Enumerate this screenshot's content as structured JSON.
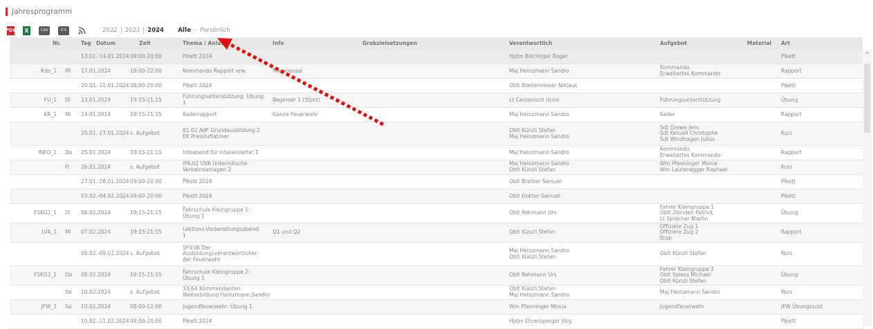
{
  "header": {
    "title": "Jahresprogramm",
    "accent_color": "#d9252a"
  },
  "toolbar": {
    "icons": [
      "pdf-icon",
      "excel-icon",
      "csv-icon",
      "ical-icon",
      "rss-icon"
    ],
    "pdf": "PDF",
    "xls": "X",
    "csv": "CSV",
    "ics": "ICS",
    "years": [
      "2022",
      "2023",
      "2024"
    ],
    "active_year": "2024",
    "filter_all": "Alle",
    "filter_sep": "-",
    "filter_personal": "Persönlich"
  },
  "table": {
    "headers": [
      "Nr.",
      "Tag",
      "Datum",
      "Zeit",
      "Thema / Anlass",
      "Info",
      "Grobzielsetzungen",
      "Verantwortlich",
      "Aufgebot",
      "Material",
      "Art"
    ],
    "rows": [
      {
        "nr": "",
        "tag": "",
        "datum": "13.01.-14.01.2024",
        "zeit": "09:00-20:00",
        "thema": "Pikett 2024",
        "info": "",
        "verant": "Hptm Blöchliger Roger",
        "aufgebot": "",
        "art": "Pikett"
      },
      {
        "nr": "Kdo_1",
        "tag": "Mi",
        "datum": "17.01.2024",
        "zeit": "19:00-22:00",
        "thema": "Kommando Rapport erw.",
        "info": "Theoriesaal",
        "verant": "Maj Heinzmann Sandro",
        "aufgebot": "Kommando\nErweitertes Kommando",
        "art": "Rapport"
      },
      {
        "nr": "",
        "tag": "",
        "datum": "20.01.-21.01.2024",
        "zeit": "09:00-20:00",
        "thema": "Pikett 2024",
        "info": "",
        "verant": "Oblt Breitenmoser Niklaus",
        "aufgebot": "",
        "art": "Pikett"
      },
      {
        "nr": "FU_1",
        "tag": "Di",
        "datum": "23.01.2024",
        "zeit": "19:15-21:15",
        "thema": "Führungsunterstützung: Übung\n1",
        "info": "Beginner 1 (Stpkt)",
        "verant": "Lt Camenisch Ursin",
        "aufgebot": "Führungsunterstützung",
        "art": "Übung"
      },
      {
        "nr": "KR_1",
        "tag": "Mi",
        "datum": "24.01.2024",
        "zeit": "19:15-21:15",
        "thema": "Kaderrapport",
        "info": "Ganze Feuerwehr",
        "verant": "Maj Heinzmann Sandro",
        "aufgebot": "Kader",
        "art": "Rapport"
      },
      {
        "nr": "",
        "tag": "",
        "datum": "25.01.-27.01.2024",
        "zeit": "s. Aufgebot",
        "thema": "61.02 AdF Grundausbildung 2\nEK Pressluftatmer",
        "info": "",
        "verant": "Oblt Künzli Stefan\nMaj Heinzmann Sandro",
        "aufgebot": "Sdt Grewe Jens\nSdt Kessell Christophe\nSdt Windhagen Julius",
        "art": "Kurs"
      },
      {
        "nr": "INFO_1",
        "tag": "Do",
        "datum": "25.01.2024",
        "zeit": "19:15-21:15",
        "thema": "Infoabend für Interessierte: 1",
        "info": "",
        "verant": "Maj Heinzmann Sandro",
        "aufgebot": "Kommando\nErweitertes Kommando",
        "art": "Rapport"
      },
      {
        "nr": "",
        "tag": "Fr",
        "datum": "26.01.2024",
        "zeit": "s. Aufgebot",
        "thema": "IPA.02 UVA Unterirdische\nVerkehrsanlagen 2",
        "info": "",
        "verant": "Maj Heinzmann Sandro\nOblt Künzli Stefan",
        "aufgebot": "Wm Pfenninger Monia\nWm Lautenegger Raphael",
        "art": "Kurs"
      },
      {
        "nr": "",
        "tag": "",
        "datum": "27.01.-28.01.2024",
        "zeit": "09:00-20:00",
        "thema": "Pikett 2024",
        "info": "",
        "verant": "Oblt Breitler Samuel",
        "aufgebot": "",
        "art": "Pikett"
      },
      {
        "nr": "",
        "tag": "",
        "datum": "03.02.-04.02.2024",
        "zeit": "09:00-20:00",
        "thema": "Pikett 2024",
        "info": "",
        "verant": "Oblt Dokter Samuel",
        "aufgebot": "",
        "art": "Pikett"
      },
      {
        "nr": "FSKG1_1",
        "tag": "Di",
        "datum": "06.02.2024",
        "zeit": "19:15-21:15",
        "thema": "Fahrschule Kleingruppe 1:\nÜbung 1",
        "info": "",
        "verant": "Oblt Rehmann Urs",
        "aufgebot": "Fahrer Kleingruppe 1\nOblt Zbinden Patrick\nLt Sprecher Martin",
        "art": "Übung"
      },
      {
        "nr": "LVA_1",
        "tag": "Mi",
        "datum": "07.02.2024",
        "zeit": "19:15-21:15",
        "thema": "Lektions-Vorbereitungsabend:\n1",
        "info": "Q1 und Q2",
        "verant": "Oblt Künzli Stefan",
        "aufgebot": "Offiziere Zug 1\nOffiziere Zug 2\nStab",
        "art": "Rapport"
      },
      {
        "nr": "",
        "tag": "",
        "datum": "08.02.-09.02.2024",
        "zeit": "s. Aufgebot",
        "thema": "SFV.06 Der\nAusbildungsverantwortlicher\nder Feuerwehr",
        "info": "",
        "verant": "Maj Heinzmann Sandro\nOblt Künzli Stefan",
        "aufgebot": "Oblt Künzli Stefan",
        "art": "Kurs"
      },
      {
        "nr": "FSKG2_1",
        "tag": "Do",
        "datum": "08.02.2024",
        "zeit": "19:15-21:15",
        "thema": "Fahrschule Kleingruppe 2:\nÜbung 1",
        "info": "",
        "verant": "Oblt Rehmann Urs",
        "aufgebot": "Fahrer Kleingruppe 2\nOblt Spiess Michael\nOblt Künzli Stefan",
        "art": "Übung"
      },
      {
        "nr": "",
        "tag": "Sa",
        "datum": "10.02.2024",
        "zeit": "s. Aufgebot",
        "thema": "33.64 Kommandanten\nWeiterbildung Heinzmann Sandro",
        "info": "",
        "verant": "Oblt Künzli Stefan\nMaj Heinzmann Sandro",
        "aufgebot": "Maj Heinzmann Sandro",
        "art": "Kurs"
      },
      {
        "nr": "JFW_1",
        "tag": "Sa",
        "datum": "10.02.2024",
        "zeit": "08:00-12:00",
        "thema": "Jugendfeuerwehr: Übung 1",
        "info": "",
        "verant": "Wm Pfenninger Monia",
        "aufgebot": "Jugendfeuerwehr",
        "art": "JFW Übungssold"
      },
      {
        "nr": "",
        "tag": "",
        "datum": "10.02.-11.02.2024",
        "zeit": "09:00-20:00",
        "thema": "Pikett 2024",
        "info": "",
        "verant": "Hptm Ehrensperger Jörg",
        "aufgebot": "",
        "art": "Pikett"
      }
    ]
  },
  "annotation": {
    "arrow_color": "#e01010"
  }
}
